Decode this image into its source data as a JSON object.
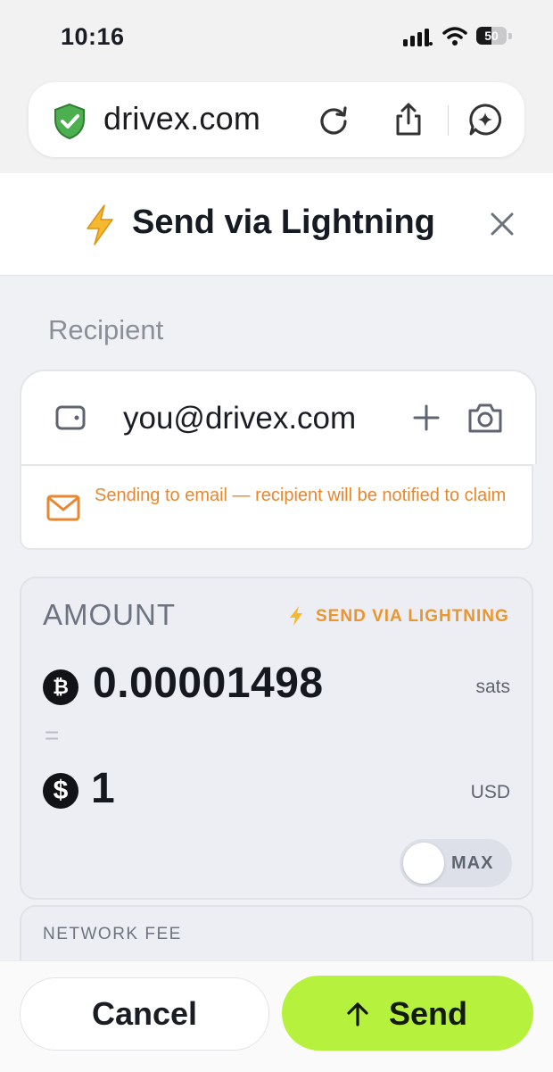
{
  "status_bar": {
    "time": "10:16",
    "battery_level": "50"
  },
  "browser": {
    "url": "drivex.com"
  },
  "dialog": {
    "title": "Send via Lightning",
    "recipient_label": "Recipient",
    "recipient_value": "you@drivex.com",
    "notice": "Sending to email — recipient will be notified to claim",
    "amount": {
      "label": "AMOUNT",
      "method": "SEND VIA LIGHTNING",
      "btc_symbol": "₿",
      "btc_value": "0.00001498",
      "btc_unit": "sats",
      "equals": "=",
      "usd_symbol": "$",
      "usd_value": "1",
      "usd_unit": "USD",
      "max_label": "MAX"
    },
    "fee_label": "NETWORK FEE"
  },
  "actions": {
    "cancel": "Cancel",
    "send": "Send"
  },
  "colors": {
    "accent_send": "#b6f23d",
    "notice_orange": "#e8872f",
    "lightning_yellow": "#f5b82e",
    "shield_green": "#4caf50"
  }
}
